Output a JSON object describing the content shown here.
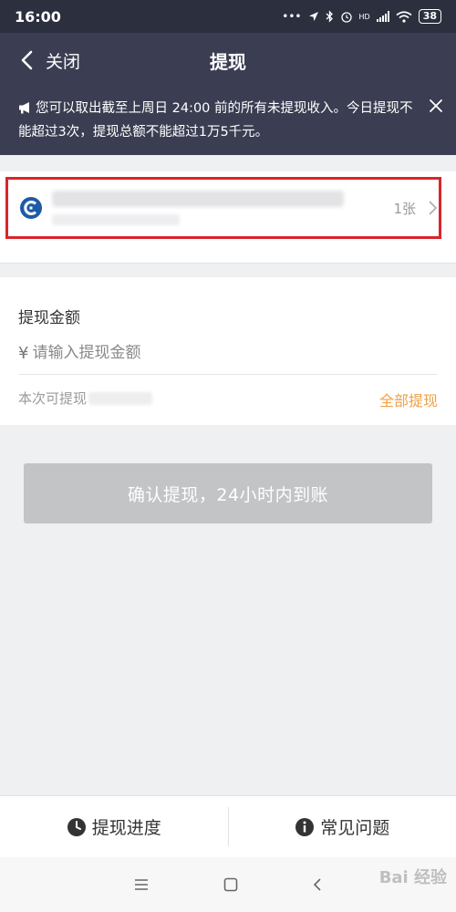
{
  "status_bar": {
    "time": "16:00",
    "battery": "38",
    "icons": [
      "dots-icon",
      "location-icon",
      "bluetooth-icon",
      "alarm-icon",
      "signal-icon",
      "wifi-icon",
      "battery-icon"
    ],
    "network_label": "HD"
  },
  "nav": {
    "back_label": "关闭",
    "title": "提现"
  },
  "notice": {
    "text": "您可以取出截至上周日 24:00 前的所有未提现收入。今日提现不能超过3次，提现总额不能超过1万5千元。"
  },
  "card": {
    "count": "1张"
  },
  "amount": {
    "label": "提现金额",
    "currency_symbol": "¥",
    "placeholder": "请输入提现金额",
    "available_label": "本次可提现",
    "withdraw_all": "全部提现"
  },
  "confirm_button": {
    "label": "确认提现，24小时内到账"
  },
  "bottom_bar": {
    "progress_label": "提现进度",
    "faq_label": "常见问题"
  },
  "watermark": "Bai 经验",
  "colors": {
    "header_bg": "#3b3e52",
    "status_bg": "#2c2f3e",
    "highlight_border": "#d9252b",
    "accent_orange": "#f0a045",
    "disabled_button": "#c3c4c6",
    "bank_blue": "#1e5aa6"
  }
}
